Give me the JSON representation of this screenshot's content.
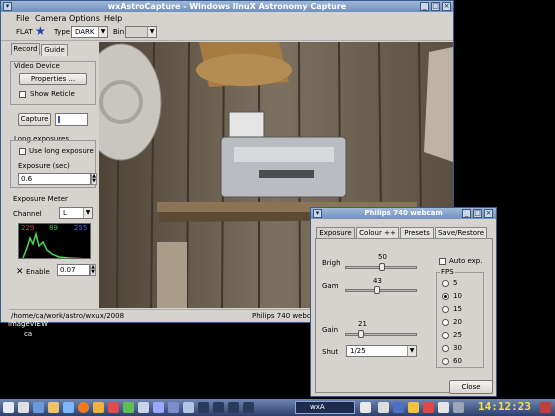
{
  "main_window": {
    "title": "wxAstroCapture - Windows linuX Astronomy Capture",
    "menu": [
      "File",
      "Camera",
      "Options",
      "Help"
    ],
    "toolbar": {
      "flat_label": "FLAT",
      "type_label": "Type",
      "type_value": "DARK",
      "bin_label": "Bin"
    },
    "tabs": [
      "Record",
      "Guide"
    ],
    "video_device": {
      "title": "Video Device",
      "properties_button": "Properties ...",
      "show_reticle": "Show Reticle"
    },
    "capture": {
      "button": "Capture"
    },
    "long_exposures": {
      "title": "Long exposures",
      "use_long_exposure": "Use long exposure",
      "exposure_label": "Exposure (sec)",
      "exposure_value": "0.6"
    },
    "exposure_meter": {
      "title": "Exposure Meter",
      "channel_label": "Channel",
      "channel_value": "L",
      "meter_min": "229",
      "meter_mid": "89",
      "meter_max": "255",
      "enable_label": "Enable",
      "enable_value": "0.07"
    },
    "status": {
      "path": "/home/ca/work/astro/wxux/2008",
      "camera": "Philips 740 webcam"
    }
  },
  "desktop": {
    "label": "imageVIEW",
    "sublabel": "ca"
  },
  "dialog": {
    "title": "Philips 740 webcam",
    "tabs": [
      "Exposure",
      "Colour ++",
      "Presets",
      "Save/Restore"
    ],
    "sliders": [
      {
        "label": "Brigh",
        "value": "50",
        "level": 0.5
      },
      {
        "label": "Gam",
        "value": "43",
        "level": 0.43
      },
      {
        "label": "Gain",
        "value": "21",
        "level": 0.21
      }
    ],
    "shutter": {
      "label": "Shut",
      "value": "1/25"
    },
    "auto_exp": "Auto exp.",
    "fps": {
      "title": "FPS",
      "options": [
        "5",
        "10",
        "15",
        "20",
        "25",
        "30",
        "60"
      ],
      "selected": "10"
    },
    "close_button": "Close"
  },
  "taskbar": {
    "active_task": "wxA",
    "clock": "14:12:23"
  },
  "colors": {
    "titlebar": "#6f8fbf",
    "window_bg": "#d6d3ce",
    "taskbar": "#2b3f6a",
    "clock": "#f4e24a"
  }
}
